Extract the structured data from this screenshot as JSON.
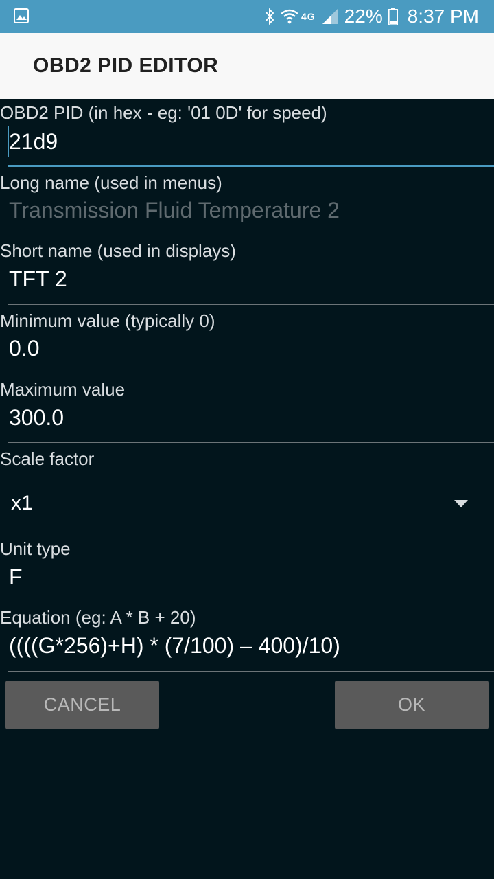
{
  "status_bar": {
    "network": "4G",
    "battery": "22%",
    "time": "8:37 PM",
    "icons": [
      "gallery-icon",
      "bluetooth-icon",
      "wifi-icon",
      "signal-icon",
      "battery-icon"
    ]
  },
  "app_bar": {
    "title": "OBD2 PID EDITOR"
  },
  "form": {
    "pid": {
      "label": "OBD2 PID (in hex - eg: '01 0D' for speed)",
      "value": "21d9"
    },
    "long_name": {
      "label": "Long name (used in menus)",
      "placeholder": "Transmission Fluid Temperature 2"
    },
    "short_name": {
      "label": "Short name (used in displays)",
      "value": "TFT 2"
    },
    "min_value": {
      "label": "Minimum value (typically 0)",
      "value": "0.0"
    },
    "max_value": {
      "label": "Maximum value",
      "value": "300.0"
    },
    "scale_factor": {
      "label": "Scale factor",
      "selected": "x1"
    },
    "unit_type": {
      "label": "Unit type",
      "value": "F"
    },
    "equation": {
      "label": "Equation (eg:  A * B + 20)",
      "value": "((((G*256)+H) * (7/100) – 400)/10)"
    }
  },
  "buttons": {
    "cancel": "CANCEL",
    "ok": "OK"
  },
  "colors": {
    "status_bar": "#4a9bc1",
    "app_bar": "#f8f8f8",
    "background": "#02151c",
    "accent": "#4a9bc1",
    "button": "#5a5a5a"
  }
}
